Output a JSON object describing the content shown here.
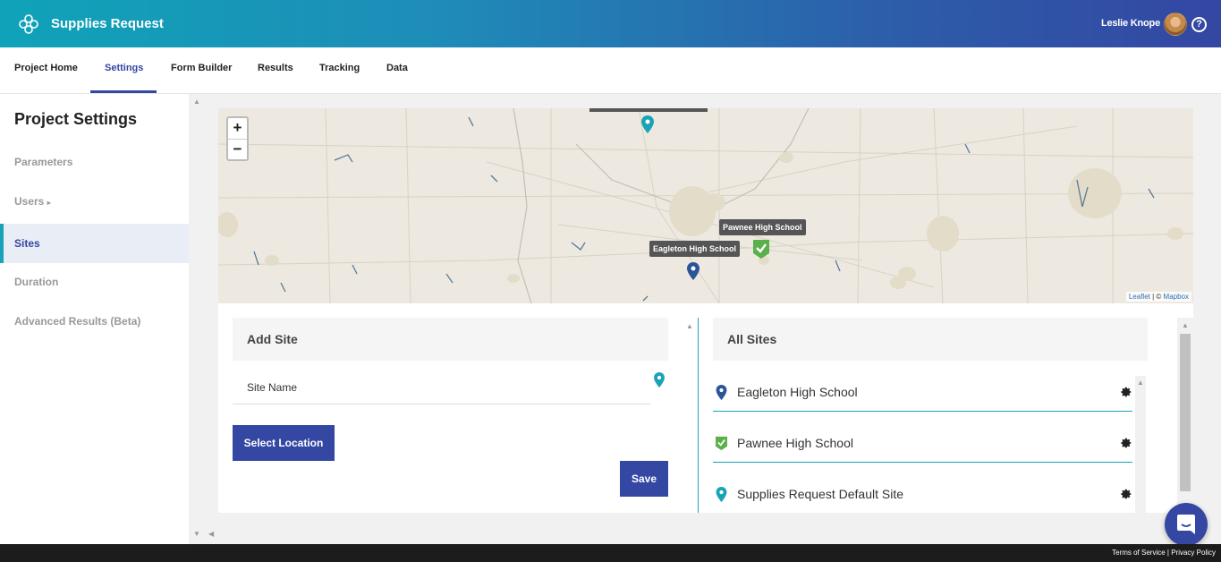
{
  "header": {
    "title": "Supplies Request",
    "user_name": "Leslie Knope",
    "help_symbol": "?"
  },
  "nav": {
    "tabs": [
      "Project Home",
      "Settings",
      "Form Builder",
      "Results",
      "Tracking",
      "Data"
    ],
    "active_tab": "Settings"
  },
  "sidebar": {
    "title": "Project Settings",
    "items": [
      "Parameters",
      "Users",
      "Sites",
      "Duration",
      "Advanced Results (Beta)"
    ],
    "users_indicator": "▸",
    "active_item": "Sites"
  },
  "map": {
    "zoom_in": "+",
    "zoom_out": "−",
    "labels": [
      "Pawnee High School",
      "Eagleton High School"
    ],
    "attribution": {
      "leaflet": "Leaflet",
      "separator": " | © ",
      "mapbox": "Mapbox"
    }
  },
  "add_site": {
    "header": "Add Site",
    "site_name_label": "Site Name",
    "select_location_button": "Select Location",
    "save_button": "Save"
  },
  "all_sites": {
    "header": "All Sites",
    "sites": [
      "Eagleton High School",
      "Pawnee High School",
      "Supplies Request Default Site"
    ]
  },
  "footer": {
    "terms": "Terms of Service",
    "separator": " | ",
    "privacy": "Privacy Policy"
  },
  "colors": {
    "brand": "#3447a3",
    "accent": "#1aa3b8",
    "pin_blue": "#2a5599",
    "check_green": "#5ab04a"
  },
  "icons": {
    "logo": "flower-logo-icon",
    "help": "help-circle-icon",
    "pin": "map-pin-icon",
    "check": "check-shield-icon",
    "gear": "gear-icon",
    "chat": "chat-bubble-icon"
  }
}
